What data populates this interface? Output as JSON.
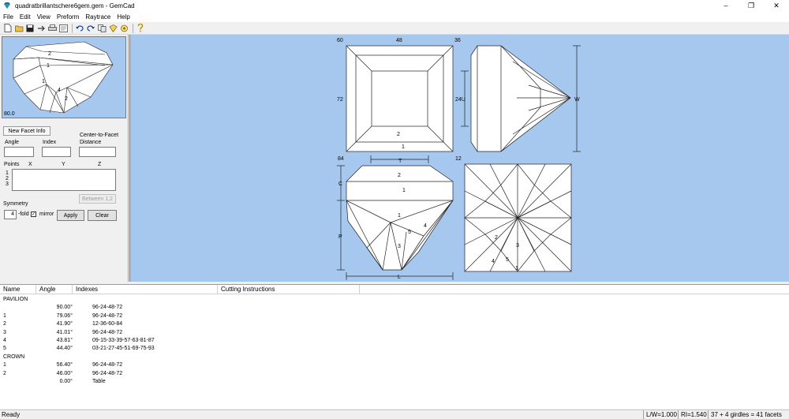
{
  "window": {
    "title": "quadratbrillantschere6gem.gem - GemCad",
    "minimize": "–",
    "maximize": "❐",
    "close": "✕"
  },
  "menu": [
    "File",
    "Edit",
    "View",
    "Preform",
    "Raytrace",
    "Help"
  ],
  "toolbar_icons": [
    "new-file-icon",
    "open-folder-icon",
    "save-icon",
    "export-icon",
    "print-icon",
    "print-preview-icon",
    "undo-icon",
    "redo-icon",
    "copy-icon",
    "preform-icon",
    "raytrace-icon",
    "help-icon"
  ],
  "preview": {
    "angle_label": "80.0",
    "facet_labels": [
      "2",
      "1",
      "1",
      "4",
      "2"
    ]
  },
  "facet_info": {
    "tab_label": "New Facet Info",
    "angle_label": "Angle",
    "index_label": "Index",
    "center_label_1": "Center-to-Facet",
    "center_label_2": "Distance",
    "points_label": "Points",
    "x_label": "X",
    "y_label": "Y",
    "z_label": "Z",
    "point_rows": [
      "1",
      "2",
      "3"
    ],
    "between_button": "Between 1,2",
    "symmetry_label": "Symmetry",
    "fold_value": "4",
    "fold_label": "-fold",
    "mirror_label": "mirror",
    "mirror_checked": "✓",
    "apply_button": "Apply",
    "clear_button": "Clear"
  },
  "views": {
    "top_labels": {
      "tl": "60",
      "tm": "48",
      "tr": "36",
      "ml": "72",
      "bl": "84",
      "br": "12"
    },
    "top_facets": {
      "inner": "2",
      "outer": "1"
    },
    "side_labels": {
      "u": "24U",
      "w": "W"
    },
    "front_labels": {
      "t": "T",
      "c": "C",
      "p": "P",
      "l": "L"
    },
    "front_facets": {
      "crown2": "2",
      "crown1": "1",
      "pav1": "1",
      "pav4": "4",
      "pav5": "5",
      "pav3": "3"
    },
    "bottom_facets": {
      "f2": "2",
      "f3": "3",
      "f4": "4",
      "f5": "5",
      "f1": "1"
    }
  },
  "table": {
    "headers": [
      "Name",
      "Angle",
      "Indexes",
      "Cutting Instructions"
    ],
    "rows": [
      {
        "name": "PAVILION",
        "angle": "",
        "indexes": ""
      },
      {
        "name": "",
        "angle": "90.00°",
        "indexes": "96-24-48-72"
      },
      {
        "name": "1",
        "angle": "79.06°",
        "indexes": "96-24-48-72"
      },
      {
        "name": "2",
        "angle": "41.90°",
        "indexes": "12-36-60-84"
      },
      {
        "name": "3",
        "angle": "41.01°",
        "indexes": "96-24-48-72"
      },
      {
        "name": "4",
        "angle": "43.81°",
        "indexes": "09-15-33-39-57-63-81-87"
      },
      {
        "name": "5",
        "angle": "44.40°",
        "indexes": "03-21-27-45-51-69-75-93"
      },
      {
        "name": "CROWN",
        "angle": "",
        "indexes": ""
      },
      {
        "name": "1",
        "angle": "56.40°",
        "indexes": "96-24-48-72"
      },
      {
        "name": "2",
        "angle": "46.00°",
        "indexes": "96-24-48-72"
      },
      {
        "name": "",
        "angle": "0.00°",
        "indexes": "Table"
      }
    ]
  },
  "status": {
    "ready": "Ready",
    "lw": "L/W=1.000",
    "ri": "RI=1.540",
    "facets": "37 + 4 girdles = 41 facets"
  }
}
